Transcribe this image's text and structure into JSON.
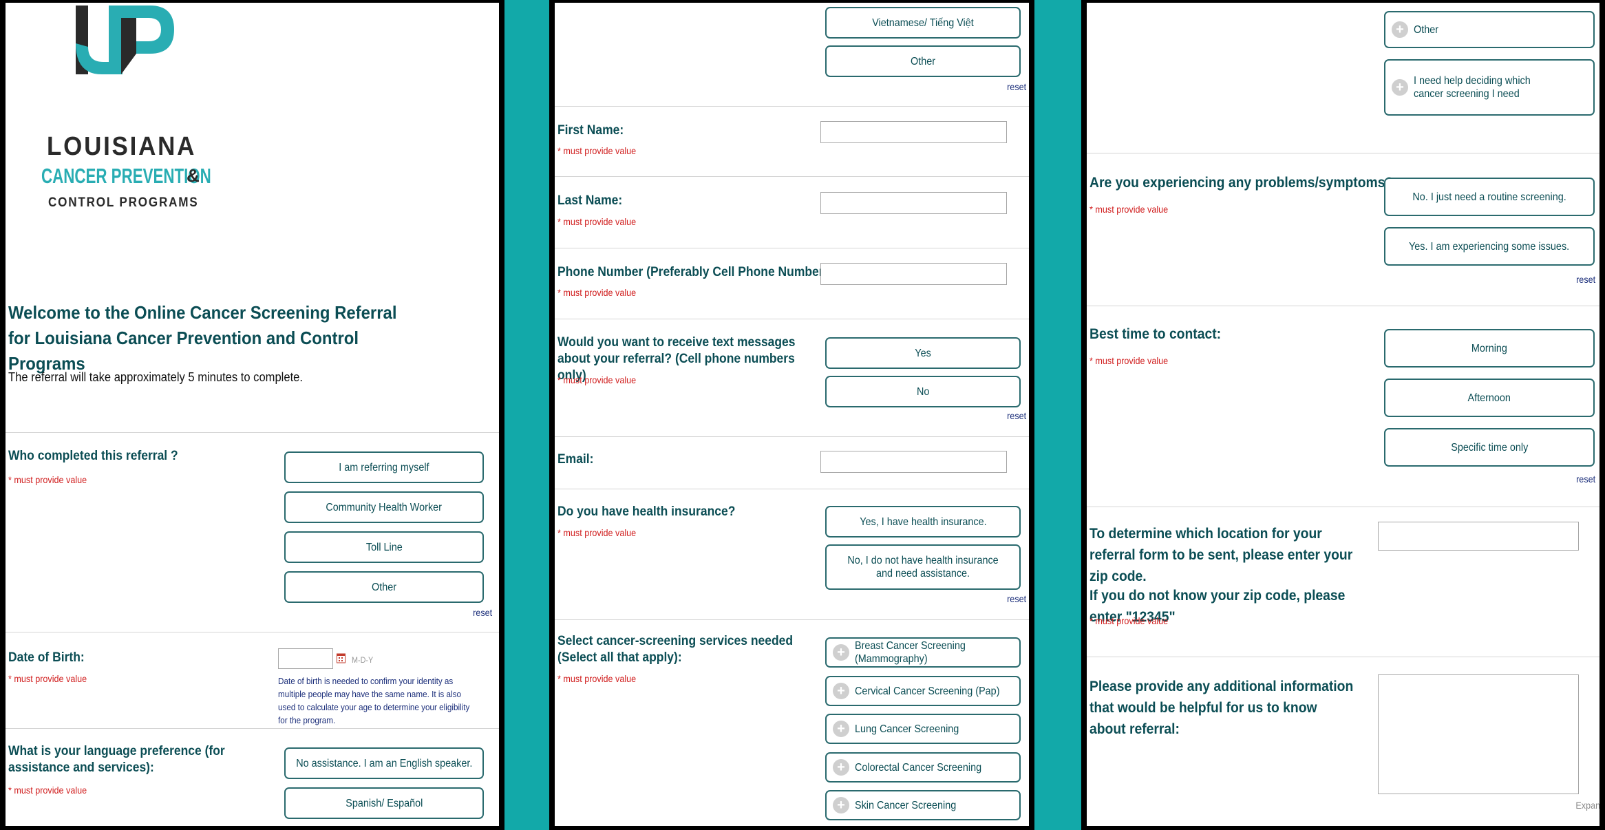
{
  "logo": {
    "line1": "LOUISIANA",
    "line2": "CANCER PREVENTION",
    "amp": "&",
    "line3": "CONTROL PROGRAMS",
    "colors": {
      "dark": "#2a2a2a",
      "teal": "#29adb3"
    }
  },
  "intro": {
    "title": "Welcome to the Online Cancer Screening Referral for Louisiana Cancer Prevention and Control Programs",
    "subtitle": "The referral will take approximately 5 minutes to complete."
  },
  "required_text": "* must provide value",
  "reset_label": "reset",
  "who_completed": {
    "label": "Who completed this referral ?",
    "options": [
      "I am referring myself",
      "Community Health Worker",
      "Toll Line",
      "Other"
    ]
  },
  "dob": {
    "label": "Date of Birth:",
    "format": "M-D-Y",
    "note": "Date of birth is needed to confirm your identity as multiple people may have the same name. It is also used to calculate your age to determine your eligibility for the program."
  },
  "language": {
    "label": "What is your language preference (for assistance and services):",
    "options_top": [
      "No assistance. I am an English speaker.",
      "Spanish/ Español"
    ],
    "options_cont": [
      "Vietnamese/ Tiếng Việt",
      "Other"
    ]
  },
  "first_name": {
    "label": "First Name:"
  },
  "last_name": {
    "label": "Last Name:"
  },
  "phone": {
    "label": "Phone Number (Preferably Cell Phone Number):"
  },
  "texts": {
    "label": "Would you want to receive text messages about your referral? (Cell phone numbers only)",
    "options": [
      "Yes",
      "No"
    ]
  },
  "email": {
    "label": "Email:"
  },
  "insurance": {
    "label": "Do you have health insurance?",
    "options": [
      "Yes, I have health insurance.",
      "No, I do not have health insurance and need assistance."
    ]
  },
  "services": {
    "label": "Select cancer-screening services needed (Select all that apply):",
    "options": [
      "Breast Cancer Screening (Mammography)",
      "Cervical Cancer Screening (Pap)",
      "Lung Cancer Screening",
      "Colorectal Cancer Screening",
      "Skin Cancer Screening"
    ],
    "options_cont": [
      "Other",
      "I need help deciding which cancer screening I need"
    ]
  },
  "symptoms": {
    "label": "Are you experiencing any problems/symptoms?",
    "options": [
      "No. I just need a routine screening.",
      "Yes. I am experiencing some issues."
    ]
  },
  "contact_time": {
    "label": "Best time to contact:",
    "options": [
      "Morning",
      "Afternoon",
      "Specific time only"
    ]
  },
  "zip": {
    "label": "To determine which location for your referral form to be sent, please enter your zip code.",
    "hint": "If you do not know your zip code, please enter \"12345\""
  },
  "additional": {
    "label": "Please provide any additional information that would be helpful for us to know about referral:",
    "expand": "Expand"
  },
  "colors": {
    "background": "#12a9a9",
    "label": "#0b4d54",
    "required": "#d12020",
    "button_border": "#2a6a6e",
    "reset": "#1b2e7a"
  }
}
